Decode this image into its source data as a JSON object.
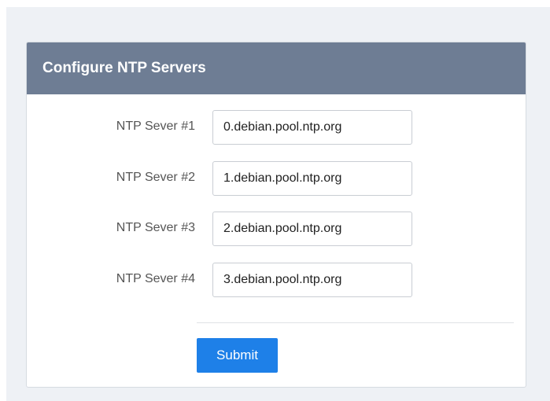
{
  "panel": {
    "title": "Configure NTP Servers"
  },
  "form": {
    "rows": [
      {
        "label": "NTP Sever #1",
        "value": "0.debian.pool.ntp.org"
      },
      {
        "label": "NTP Sever #2",
        "value": "1.debian.pool.ntp.org"
      },
      {
        "label": "NTP Sever #3",
        "value": "2.debian.pool.ntp.org"
      },
      {
        "label": "NTP Sever #4",
        "value": "3.debian.pool.ntp.org"
      }
    ],
    "submit_label": "Submit"
  },
  "colors": {
    "header": "#6e7d94",
    "button": "#1e80e8",
    "background": "#eef1f5"
  }
}
